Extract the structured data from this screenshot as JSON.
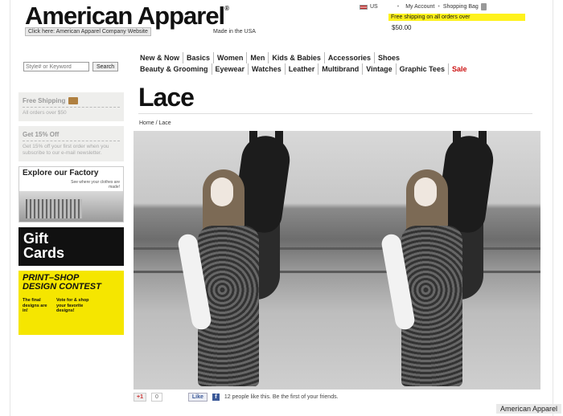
{
  "header": {
    "logo": "American Apparel",
    "logo_mark": "®",
    "company_link": "Click here: American Apparel Company Website",
    "made_in": "Made in the USA",
    "region": "US",
    "my_account": "My Account",
    "shopping_bag": "Shopping Bag",
    "free_shipping": "Free shipping on all orders over",
    "free_shipping_amount": "$50.00"
  },
  "search": {
    "placeholder": "Style# or Keyword",
    "button": "Search"
  },
  "nav": {
    "row1": [
      "New & Now",
      "Basics",
      "Women",
      "Men",
      "Kids & Babies",
      "Accessories",
      "Shoes"
    ],
    "row2": [
      "Beauty & Grooming",
      "Eyewear",
      "Watches",
      "Leather",
      "Multibrand",
      "Vintage",
      "Graphic Tees",
      "Sale"
    ]
  },
  "sidebar": {
    "shipping_title": "Free Shipping",
    "shipping_text": "All orders over $50",
    "discount_title": "Get 15% Off",
    "discount_text": "Get 15% off your first order when you subscribe to our e-mail newsletter.",
    "factory_title": "Explore our Factory",
    "factory_sub": "See where your clothes are made!",
    "gift_line1": "Gift",
    "gift_line2": "Cards",
    "contest_line1": "PRINT–SHOP",
    "contest_line2": "DESIGN CONTEST",
    "contest_col1": "The final designs are in!",
    "contest_col2": "Vote for & shop your favorite designs!"
  },
  "main": {
    "title": "Lace",
    "breadcrumb": "Home / Lace"
  },
  "social": {
    "gplus": "+1",
    "gplus_count": "0",
    "like": "Like",
    "like_text": "12 people like this. Be the first of your friends."
  },
  "watermark": "American Apparel",
  "colors": {
    "sale": "#cc1111",
    "banner": "#fff21c",
    "contest": "#f5e600"
  }
}
